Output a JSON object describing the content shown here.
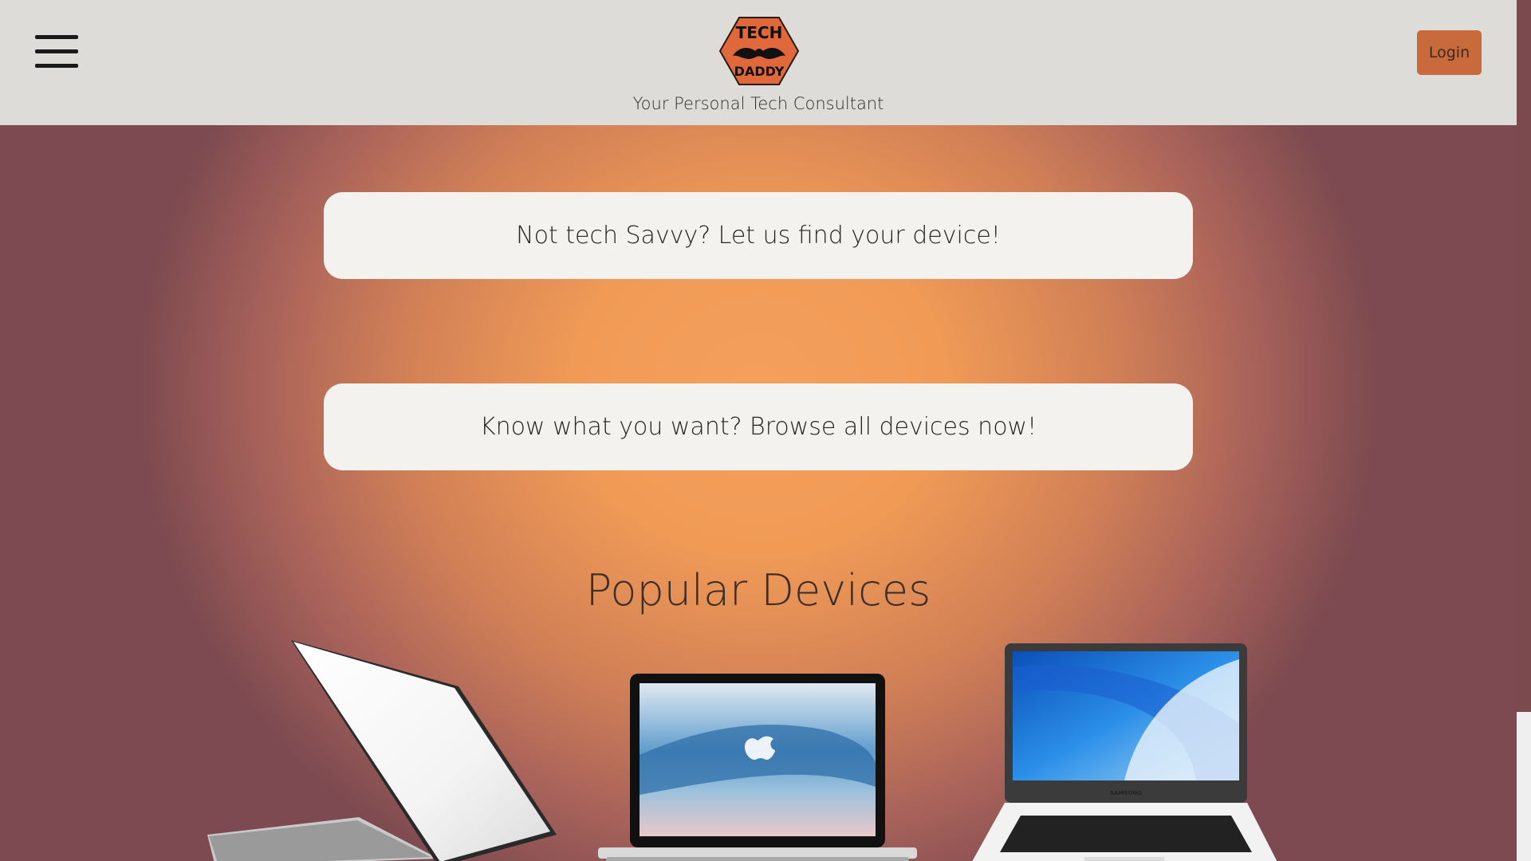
{
  "header": {
    "menu_icon": "hamburger-menu-icon",
    "logo": {
      "top_text": "TECH",
      "bottom_text": "DADDY",
      "icon": "mustache-icon"
    },
    "tagline": "Your Personal Tech Consultant",
    "login_label": "Login"
  },
  "main": {
    "cta_find": "Not tech Savvy? Let us find your device!",
    "cta_browse": "Know what you want? Browse all devices now!",
    "popular_title": "Popular Devices",
    "devices": [
      {
        "icon": "white-laptop-image"
      },
      {
        "icon": "macbook-image"
      },
      {
        "icon": "samsung-laptop-image",
        "brand": "SAMSUNG"
      }
    ]
  },
  "colors": {
    "header_bg": "#dedcd9",
    "accent": "#c86a3c",
    "gradient_center": "#f4a05c",
    "gradient_edge": "#7c4a50",
    "card_bg": "#f4f2ee"
  }
}
